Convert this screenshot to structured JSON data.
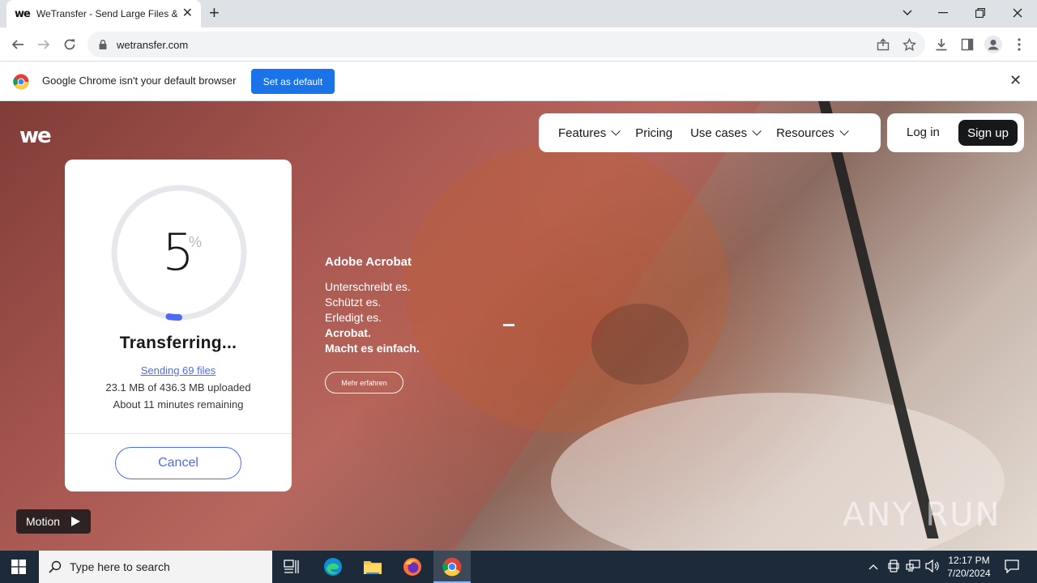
{
  "browser": {
    "tab_title": "WeTransfer - Send Large Files & ",
    "tab_favicon": "we",
    "new_tab_symbol": "+",
    "url": "wetransfer.com"
  },
  "infobar": {
    "message": "Google Chrome isn't your default browser",
    "button": "Set as default"
  },
  "site": {
    "logo": "we",
    "nav": [
      {
        "label": "Features"
      },
      {
        "label": "Pricing"
      },
      {
        "label": "Use cases"
      },
      {
        "label": "Resources"
      }
    ],
    "login": "Log in",
    "signup": "Sign up"
  },
  "transfer": {
    "percent": "5",
    "percent_symbol": "%",
    "progress": 0.05,
    "status": "Transferring...",
    "sending": "Sending 69 files",
    "uploaded": "23.1 MB of 436.3 MB uploaded",
    "remaining": "About 11 minutes remaining",
    "cancel": "Cancel"
  },
  "ad": {
    "brand": "Adobe Acrobat",
    "lines": [
      "Unterschreibt es.",
      "Schützt es.",
      "Erledigt es."
    ],
    "bold_lines": [
      "Acrobat.",
      "Macht es einfach."
    ],
    "button": "Mehr erfahren"
  },
  "motion": {
    "label": "Motion"
  },
  "watermark": "ANY RUN",
  "taskbar": {
    "search_placeholder": "Type here to search",
    "time": "12:17 PM",
    "date": "7/20/2024"
  },
  "colors": {
    "accent_blue": "#4a6cf7",
    "chrome_blue": "#1a73e8",
    "dark": "#17181a"
  }
}
